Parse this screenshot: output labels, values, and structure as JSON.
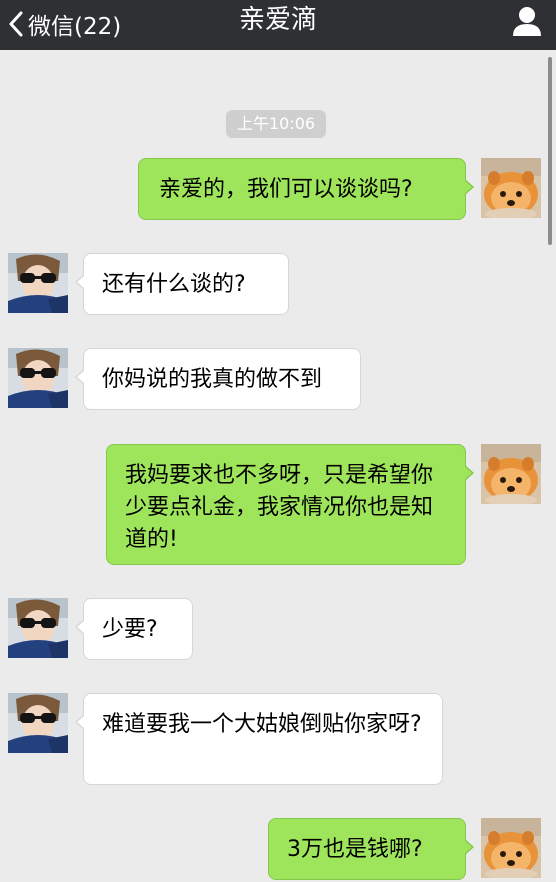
{
  "header": {
    "back_label": "微信(22)",
    "title": "亲爱滴",
    "profile_icon": "person-icon"
  },
  "timestamp": "上午10:06",
  "messages": [
    {
      "side": "right",
      "text": "亲爱的，我们可以谈谈吗?"
    },
    {
      "side": "left",
      "text": "还有什么谈的?"
    },
    {
      "side": "left",
      "text": "你妈说的我真的做不到"
    },
    {
      "side": "right",
      "text": "我妈要求也不多呀，只是希望你少要点礼金，我家情况你也是知道的!"
    },
    {
      "side": "left",
      "text": "少要?"
    },
    {
      "side": "left",
      "text": "难道要我一个大姑娘倒贴你家呀?"
    },
    {
      "side": "right",
      "text": "3万也是钱哪?"
    }
  ],
  "colors": {
    "header_bg": "#2e3033",
    "background": "#ebebeb",
    "sent_bubble": "#9fe55c",
    "received_bubble": "#ffffff"
  }
}
